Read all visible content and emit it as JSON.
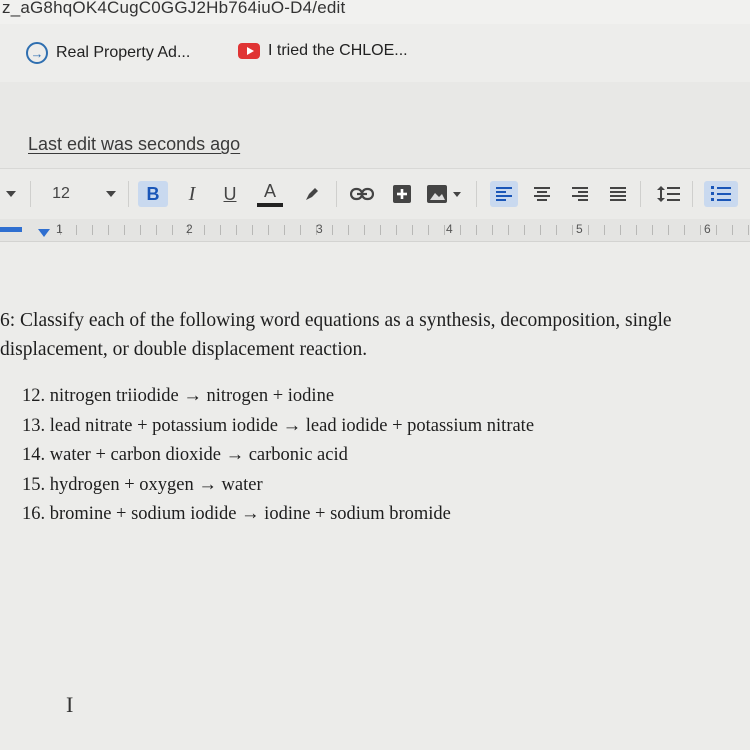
{
  "browser": {
    "url_fragment": "z_aG8hqOK4CugC0GGJ2Hb764iuO-D4/edit",
    "bookmarks": [
      {
        "label": "Real Property Ad...",
        "icon": "arrow-circle-icon"
      },
      {
        "label": "I tried the CHLOE...",
        "icon": "youtube-icon"
      }
    ]
  },
  "doc": {
    "last_edit": "Last edit was seconds ago"
  },
  "toolbar": {
    "font_size": "12",
    "bold": "B",
    "italic": "I",
    "underline": "U",
    "text_color": "A",
    "accent_color": "#1a56b8",
    "active_bg": "#c9d9ef"
  },
  "ruler": {
    "numbers": [
      "1",
      "2",
      "3",
      "4",
      "5",
      "6"
    ]
  },
  "content": {
    "question_line1": "6:  Classify each of the following word equations as a synthesis, decomposition, single",
    "question_line2": "displacement, or double displacement reaction.",
    "equations": [
      "12. nitrogen triiodide → nitrogen + iodine",
      "13. lead nitrate + potassium iodide → lead iodide + potassium nitrate",
      "14. water + carbon dioxide → carbonic acid",
      "15. hydrogen + oxygen → water",
      "16. bromine + sodium iodide → iodine + sodium bromide"
    ]
  }
}
